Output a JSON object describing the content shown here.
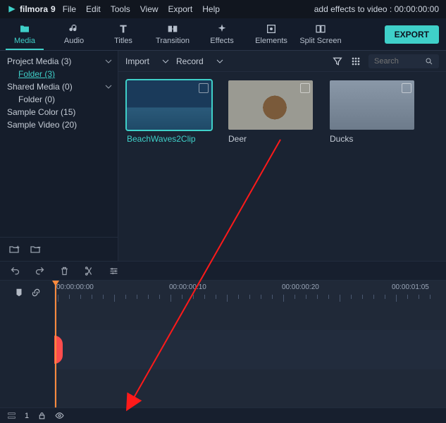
{
  "app": {
    "name": "filmora",
    "version": "9"
  },
  "menu": {
    "file": "File",
    "edit": "Edit",
    "tools": "Tools",
    "view": "View",
    "export": "Export",
    "help": "Help"
  },
  "title_right": {
    "text": "add effects to video : 00:00:00:00"
  },
  "tooltabs": {
    "media": "Media",
    "audio": "Audio",
    "titles": "Titles",
    "transition": "Transition",
    "effects": "Effects",
    "elements": "Elements",
    "split": "Split Screen"
  },
  "export_button": "EXPORT",
  "sidebar": {
    "items": [
      {
        "label": "Project Media (3)",
        "expandable": true
      },
      {
        "label": "Folder (3)",
        "link": true,
        "child": true
      },
      {
        "label": "Shared Media (0)",
        "expandable": true
      },
      {
        "label": "Folder (0)",
        "child": true
      },
      {
        "label": "Sample Color (15)"
      },
      {
        "label": "Sample Video (20)"
      }
    ]
  },
  "browser_bar": {
    "import": "Import",
    "record": "Record",
    "search_placeholder": "Search"
  },
  "clips": [
    {
      "label": "BeachWaves2Clip",
      "selected": true,
      "kind": "sea"
    },
    {
      "label": "Deer",
      "selected": false,
      "kind": "deer"
    },
    {
      "label": "Ducks",
      "selected": false,
      "kind": "ducks"
    }
  ],
  "timeline": {
    "labels": [
      "00:00:00:00",
      "00:00:00:10",
      "00:00:00:20",
      "00:00:01:05"
    ]
  },
  "bottom": {
    "track_count": "1"
  }
}
